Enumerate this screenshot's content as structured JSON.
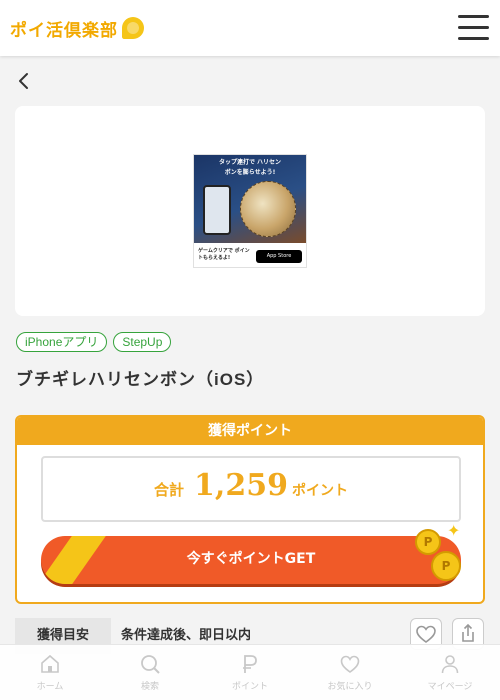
{
  "header": {
    "logo_text": "ポイ活倶楽部",
    "logo_icon": "bee-mascot-icon",
    "menu_icon": "hamburger-menu-icon"
  },
  "nav": {
    "back_icon": "chevron-left-icon"
  },
  "banner": {
    "headline": "タップ連打で ハリセンボンを膨らせよう!",
    "caption": "ゲームクリアで ポイントもらえるよ!",
    "store_badge": "App Store"
  },
  "tags": [
    "iPhoneアプリ",
    "StepUp"
  ],
  "title": "ブチギレハリセンボン（iOS）",
  "points": {
    "header": "獲得ポイント",
    "total_label": "合計",
    "total_value": "1,259",
    "total_unit": "ポイント",
    "get_button": "今すぐポイントGET",
    "coin_glyph": "P"
  },
  "info": {
    "label": "獲得目安",
    "value": "条件達成後、即日以内"
  },
  "actions": {
    "favorite_icon": "heart-icon",
    "share_icon": "share-icon"
  },
  "bottom_nav": [
    {
      "label": "ホーム",
      "icon": "home-icon"
    },
    {
      "label": "検索",
      "icon": "search-icon"
    },
    {
      "label": "ポイント",
      "icon": "point-icon"
    },
    {
      "label": "お気に入り",
      "icon": "heart-icon"
    },
    {
      "label": "マイページ",
      "icon": "user-icon"
    }
  ],
  "colors": {
    "accent_orange": "#f0a91e",
    "button_red": "#f05a28",
    "tag_green": "#36a33c",
    "coin_gold": "#f5c518"
  }
}
